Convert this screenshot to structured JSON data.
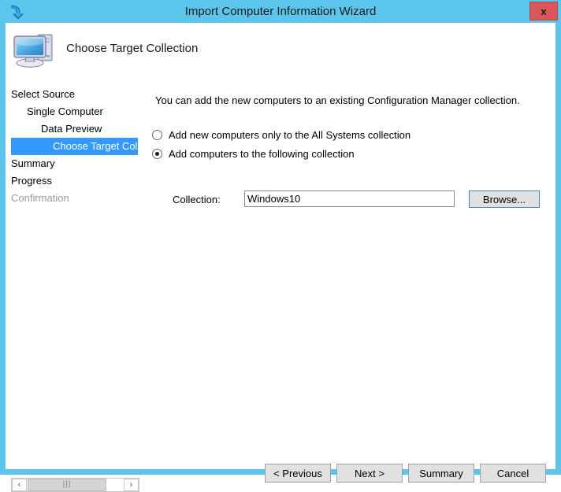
{
  "window": {
    "title": "Import Computer Information Wizard",
    "title_icon": "blue-curved-arrow-icon",
    "close_label": "x",
    "frame_color": "#5bc5ec",
    "close_color": "#d9565a"
  },
  "header": {
    "icon": "computer-icon",
    "title": "Choose Target Collection"
  },
  "nav": {
    "items": [
      {
        "label": "Select Source",
        "level": 0,
        "state": "done"
      },
      {
        "label": "Single Computer",
        "level": 1,
        "state": "done"
      },
      {
        "label": "Data Preview",
        "level": 2,
        "state": "done"
      },
      {
        "label": "Choose Target Collect",
        "level": 3,
        "state": "selected"
      },
      {
        "label": "Summary",
        "level": 0,
        "state": "done"
      },
      {
        "label": "Progress",
        "level": 0,
        "state": "done"
      },
      {
        "label": "Confirmation",
        "level": 0,
        "state": "disabled"
      }
    ],
    "selected_color": "#3399ff"
  },
  "main": {
    "intro": "You can add the new computers to an existing Configuration Manager collection.",
    "options": [
      {
        "label": "Add new computers only to the All Systems collection",
        "checked": false
      },
      {
        "label": "Add computers to the following collection",
        "checked": true
      }
    ],
    "collection_label": "Collection:",
    "collection_value": "Windows10",
    "collection_placeholder": "",
    "browse_label": "Browse..."
  },
  "footer": {
    "buttons": [
      {
        "label": "< Previous"
      },
      {
        "label": "Next >"
      },
      {
        "label": "Summary"
      },
      {
        "label": "Cancel"
      }
    ]
  },
  "scrollbar": {
    "left_arrow": "‹",
    "right_arrow": "›",
    "thumb_grip": "|||"
  }
}
